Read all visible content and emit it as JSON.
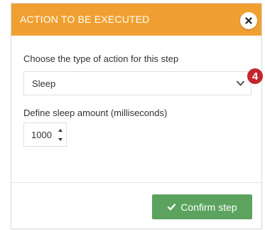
{
  "dialog": {
    "title": "ACTION TO BE EXECUTED",
    "close_icon": "close-icon"
  },
  "action_type": {
    "label": "Choose the type of action for this step",
    "selected_value": "Sleep",
    "icon": "chevron-down-icon"
  },
  "step_badge": "4",
  "sleep": {
    "label": "Define sleep amount (milliseconds)",
    "value": "1000"
  },
  "footer": {
    "confirm_label": "Confirm step",
    "confirm_icon": "check-icon"
  },
  "colors": {
    "header": "#f0a030",
    "confirm": "#5ba35e",
    "badge": "#c4262e"
  }
}
